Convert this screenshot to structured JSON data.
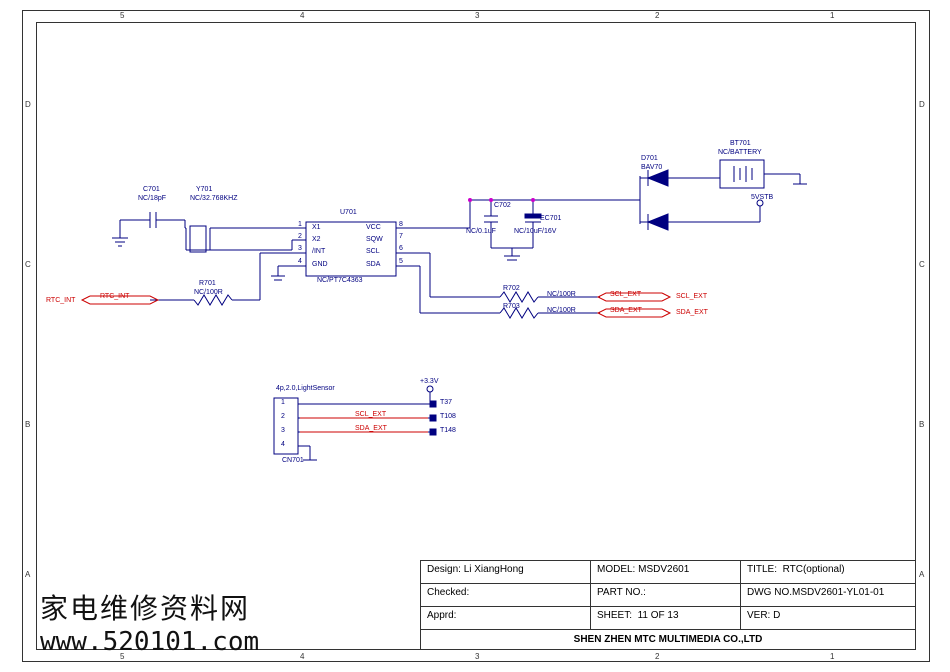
{
  "ruler_top": [
    "5",
    "4",
    "3",
    "2",
    "1"
  ],
  "ruler_side": [
    "D",
    "C",
    "B",
    "A"
  ],
  "rtc": {
    "C701_ref": "C701",
    "C701_val": "NC/18pF",
    "Y701_ref": "Y701",
    "Y701_val": "NC/32.768KHZ",
    "U701_ref": "U701",
    "U701_val": "NC/PT7C4363",
    "U701_pins_left": [
      "X1",
      "X2",
      "/INT",
      "GND"
    ],
    "U701_pins_right": [
      "VCC",
      "SQW",
      "SCL",
      "SDA"
    ],
    "U701_nums_left": [
      "1",
      "2",
      "3",
      "4"
    ],
    "U701_nums_right": [
      "8",
      "7",
      "6",
      "5"
    ],
    "R701_ref": "R701",
    "R701_val": "NC/100R",
    "net_rtc_int": "RTC_INT",
    "C702_ref": "C702",
    "C702_val": "NC/0.1uF",
    "EC701_ref": "EC701",
    "EC701_val": "NC/10uF/16V",
    "D701_ref": "D701",
    "D701_val": "BAV70",
    "BT701_ref": "BT701",
    "BT701_val": "NC/BATTERY",
    "pwr_5v": "5VSTB",
    "R702_ref": "R702",
    "R702_val": "NC/100R",
    "R703_ref": "R703",
    "R703_val": "NC/100R",
    "net_scl": "SCL_EXT",
    "net_sda": "SDA_EXT"
  },
  "ls": {
    "header": "4p,2.0,LightSensor",
    "CN701_ref": "CN701",
    "pins": [
      "1",
      "2",
      "3",
      "4"
    ],
    "pwr_3v3": "+3.3V",
    "net_scl": "SCL_EXT",
    "net_sda": "SDA_EXT",
    "tp1": "T37",
    "tp2": "T108",
    "tp3": "T148"
  },
  "tb": {
    "design_l": "Design:",
    "design_v": "Li XiangHong",
    "model_l": "MODEL:",
    "model_v": "MSDV2601",
    "title_l": "TITLE:",
    "title_v": "RTC(optional)",
    "checked": "Checked:",
    "partno_l": "PART NO.:",
    "partno_v": "",
    "dwg_l": "DWG NO.",
    "dwg_v": "MSDV2601-YL01-01",
    "apprd": "Apprd:",
    "sheet_l": "SHEET:",
    "sheet_v": "11  OF  13",
    "ver_l": "VER:",
    "ver_v": "D",
    "footer": "SHEN ZHEN MTC MULTIMEDIA CO.,LTD"
  },
  "watermark": {
    "cn": "家电维修资料网",
    "url": "www.520101.com"
  }
}
